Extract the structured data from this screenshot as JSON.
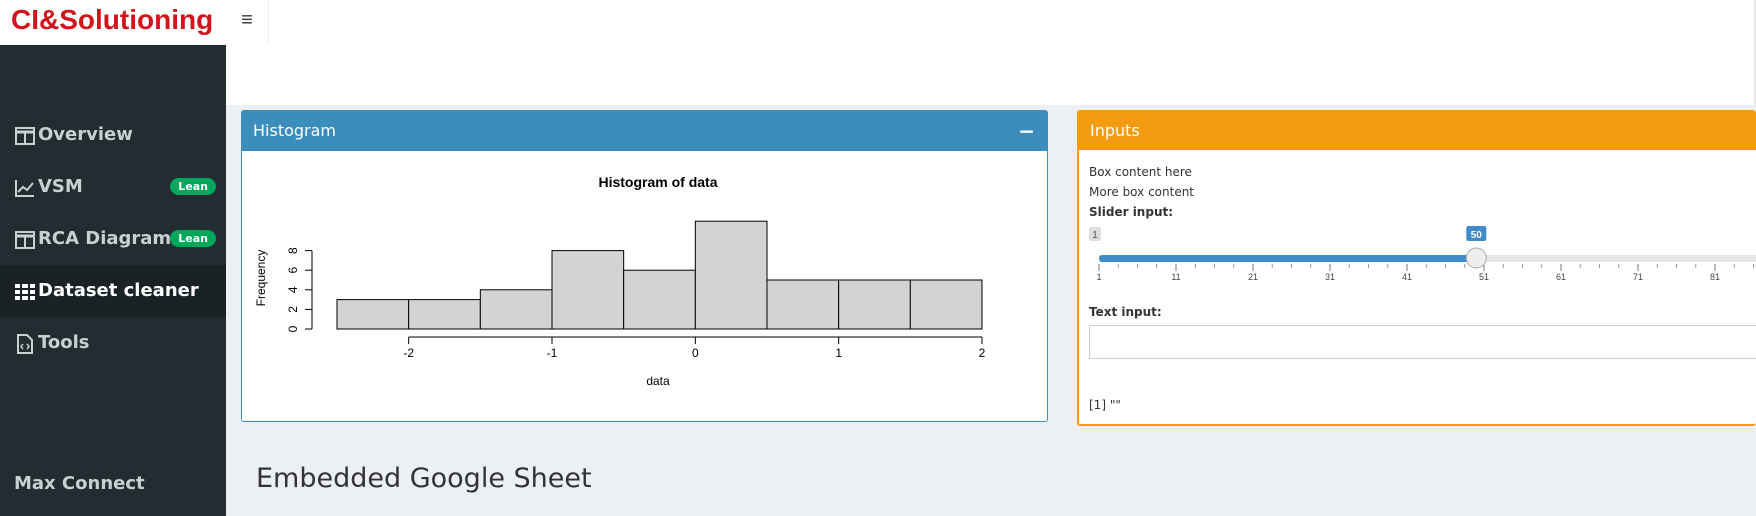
{
  "header": {
    "logo": "CI&Solutioning",
    "menu_icon": "≡"
  },
  "sidebar": {
    "items": [
      {
        "label": "Overview",
        "icon": "table-icon",
        "badge": ""
      },
      {
        "label": "VSM",
        "icon": "line-chart-icon",
        "badge": "Lean"
      },
      {
        "label": "RCA Diagrams",
        "icon": "table-icon",
        "badge": "Lean"
      },
      {
        "label": "Dataset cleaner",
        "icon": "grid-icon",
        "badge": ""
      },
      {
        "label": "Tools",
        "icon": "file-code-icon",
        "badge": ""
      }
    ],
    "footer": "Max Connect"
  },
  "histogram_box": {
    "title": "Histogram",
    "collapse_icon": "−"
  },
  "chart_data": {
    "type": "bar",
    "title": "Histogram of data",
    "xlabel": "data",
    "ylabel": "Frequency",
    "bins": [
      [
        -2.5,
        -2
      ],
      [
        -2,
        -1.5
      ],
      [
        -1.5,
        -1
      ],
      [
        -1,
        -0.5
      ],
      [
        -0.5,
        0
      ],
      [
        0,
        0.5
      ],
      [
        0.5,
        1
      ],
      [
        1,
        1.5
      ],
      [
        1.5,
        2
      ]
    ],
    "values": [
      3,
      3,
      4,
      8,
      6,
      11,
      5,
      5,
      5
    ],
    "x_ticks": [
      "-2",
      "-1",
      "0",
      "1",
      "2"
    ],
    "y_ticks": [
      "0",
      "2",
      "4",
      "6",
      "8"
    ],
    "xlim": [
      -2.5,
      2
    ],
    "ylim": [
      0,
      10
    ],
    "bar_color": "#d3d3d3",
    "grid": false
  },
  "inputs_box": {
    "title": "Inputs",
    "line1": "Box content here",
    "line2": "More box content",
    "slider_label": "Slider input:",
    "slider_min": "1",
    "slider_value": "50",
    "slider_value_num": 50,
    "slider_range": [
      1,
      100
    ],
    "slider_ticks": [
      "1",
      "11",
      "21",
      "31",
      "41",
      "51",
      "61",
      "71",
      "81"
    ],
    "text_label": "Text input:",
    "text_value": "",
    "output": "[1] \"\""
  },
  "section": {
    "title": "Embedded Google Sheet"
  }
}
